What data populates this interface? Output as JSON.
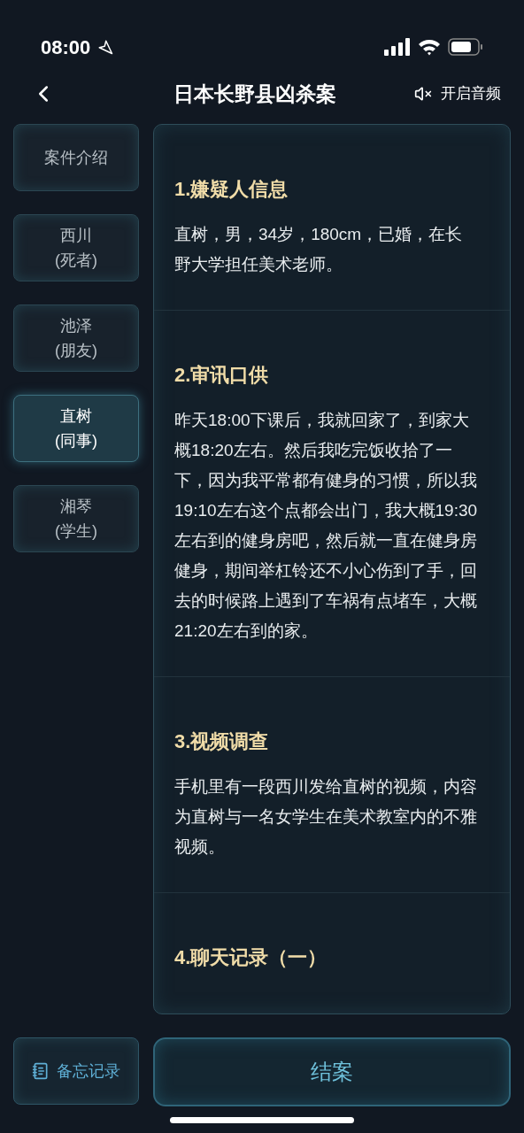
{
  "status_bar": {
    "time": "08:00"
  },
  "header": {
    "title": "日本长野县凶杀案",
    "audio_label": "开启音频",
    "muted": true
  },
  "tabs": [
    {
      "name": "案件介绍",
      "selected": false
    },
    {
      "name": "西川",
      "role": "(死者)",
      "selected": false
    },
    {
      "name": "池泽",
      "role": "(朋友)",
      "selected": false
    },
    {
      "name": "直树",
      "role": "(同事)",
      "selected": true
    },
    {
      "name": "湘琴",
      "role": "(学生)",
      "selected": false
    }
  ],
  "sections": [
    {
      "heading": "1.嫌疑人信息",
      "body": "直树，男，34岁，180cm，已婚，在长野大学担任美术老师。"
    },
    {
      "heading": "2.审讯口供",
      "body": "昨天18:00下课后，我就回家了，到家大概18:20左右。然后我吃完饭收拾了一下，因为我平常都有健身的习惯，所以我19:10左右这个点都会出门，我大概19:30左右到的健身房吧，然后就一直在健身房健身，期间举杠铃还不小心伤到了手，回去的时候路上遇到了车祸有点堵车，大概21:20左右到的家。"
    },
    {
      "heading": "3.视频调查",
      "body": "手机里有一段西川发给直树的视频，内容为直树与一名女学生在美术教室内的不雅视频。"
    },
    {
      "heading": "4.聊天记录（一）"
    }
  ],
  "buttons": {
    "notes": "备忘记录",
    "close_case": "结案"
  }
}
